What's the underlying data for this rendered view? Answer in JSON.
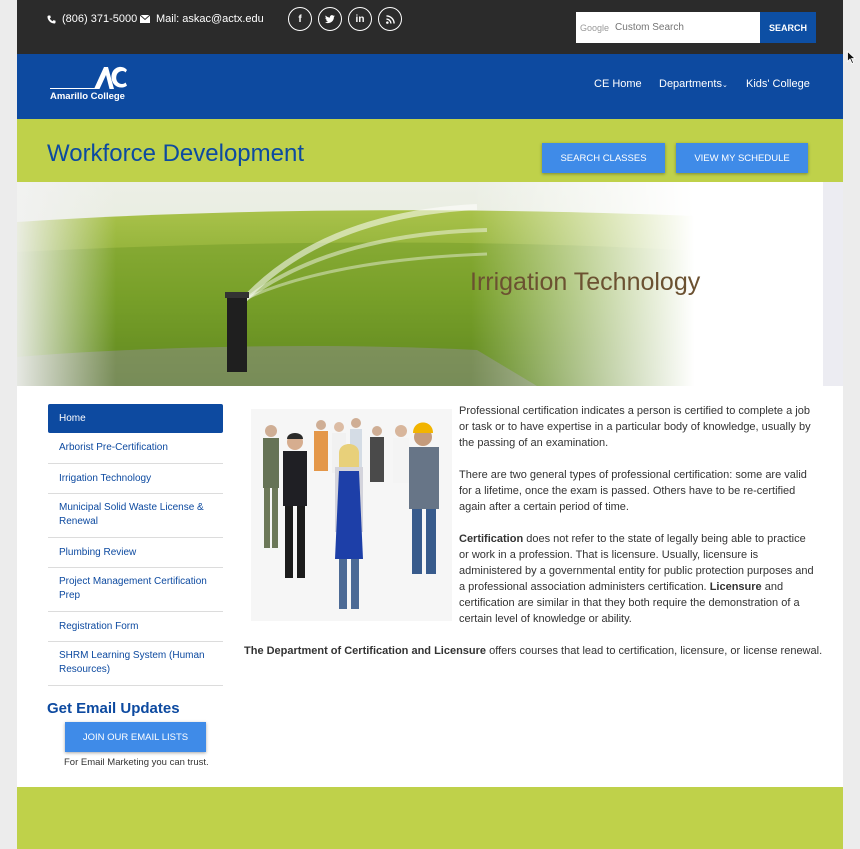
{
  "topbar": {
    "phone": "(806) 371-5000",
    "mail": "Mail: askac@actx.edu",
    "social": [
      "f",
      "t",
      "in",
      "rss"
    ],
    "search_brand": "Google",
    "search_placeholder": "Custom Search",
    "search_button": "SEARCH"
  },
  "brand": {
    "logo_letters": "AC",
    "name": "Amarillo College"
  },
  "nav": {
    "items": [
      "CE Home",
      "Departments",
      "Kids' College"
    ]
  },
  "header": {
    "title": "Workforce Development",
    "btn_search_classes": "SEARCH CLASSES",
    "btn_view_schedule": "VIEW MY SCHEDULE"
  },
  "hero": {
    "caption": "Irrigation Technology"
  },
  "sidebar": {
    "items": [
      "Home",
      "Arborist Pre-Certification",
      "Irrigation Technology",
      "Municipal Solid Waste License & Renewal",
      "Plumbing Review",
      "Project Management Certification Prep",
      "Registration Form",
      "SHRM Learning System (Human Resources)"
    ],
    "email_heading": "Get Email Updates",
    "email_button": "JOIN OUR EMAIL LISTS",
    "email_note": "For Email Marketing you can trust."
  },
  "content": {
    "p1": "Professional certification indicates a person is certified to complete a job or task or to have expertise in a particular body of knowledge, usually by the passing of an examination.",
    "p2": "There are two general types of professional certification: some are valid for a lifetime, once the exam is passed. Others have to be re-certified again after a certain period of time.",
    "p3_bold1": "Certification",
    "p3_text1": " does not refer to the state of legally being able to practice or work in a profession. That is licensure. Usually, licensure is administered by a governmental entity for public protection purposes and a professional association administers certification. ",
    "p3_bold2": "Licensure",
    "p3_text2": " and certification are similar in that they both require the demonstration of a certain level of knowledge or ability.",
    "dept_bold": "The Department of Certification and Licensure",
    "dept_text": " offers courses that lead to certification, licensure, or license renewal."
  }
}
